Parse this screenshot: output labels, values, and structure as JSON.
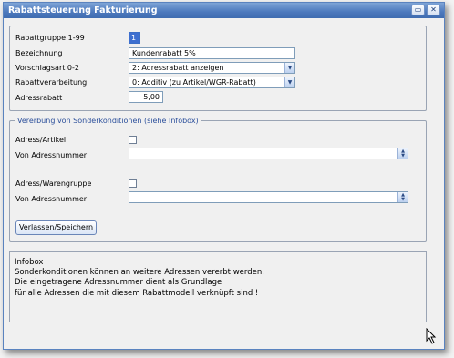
{
  "window": {
    "title": "Rabattsteuerung Fakturierung"
  },
  "titlebar_buttons": {
    "minimize": "▭",
    "close": "✕"
  },
  "form": {
    "rabattgruppe_label": "Rabattgruppe 1-99",
    "rabattgruppe_value": "1",
    "bezeichnung_label": "Bezeichnung",
    "bezeichnung_value": "Kundenrabatt 5%",
    "vorschlagsart_label": "Vorschlagsart 0-2",
    "vorschlagsart_value": "2: Adressrabatt anzeigen",
    "rabattverarbeitung_label": "Rabattverarbeitung",
    "rabattverarbeitung_value": "0: Additiv (zu Artikel/WGR-Rabatt)",
    "adressrabatt_label": "Adressrabatt",
    "adressrabatt_value": "5,00"
  },
  "vererbung": {
    "legend": "Vererbung von Sonderkonditionen (siehe Infobox)",
    "adress_artikel_label": "Adress/Artikel",
    "von_adressnummer1_label": "Von Adressnummer",
    "adress_warengruppe_label": "Adress/Warengruppe",
    "von_adressnummer2_label": "Von Adressnummer",
    "save_button": "Verlassen/Speichern"
  },
  "infobox": {
    "text": "Infobox\nSonderkonditionen können an weitere Adressen vererbt werden.\nDie eingetragene Adressnummer dient als Grundlage\nfür alle Adressen die mit diesem Rabattmodell verknüpft sind !"
  },
  "icons": {
    "dropdown": "▼",
    "spinner_up": "▲",
    "spinner_down": "▼"
  }
}
